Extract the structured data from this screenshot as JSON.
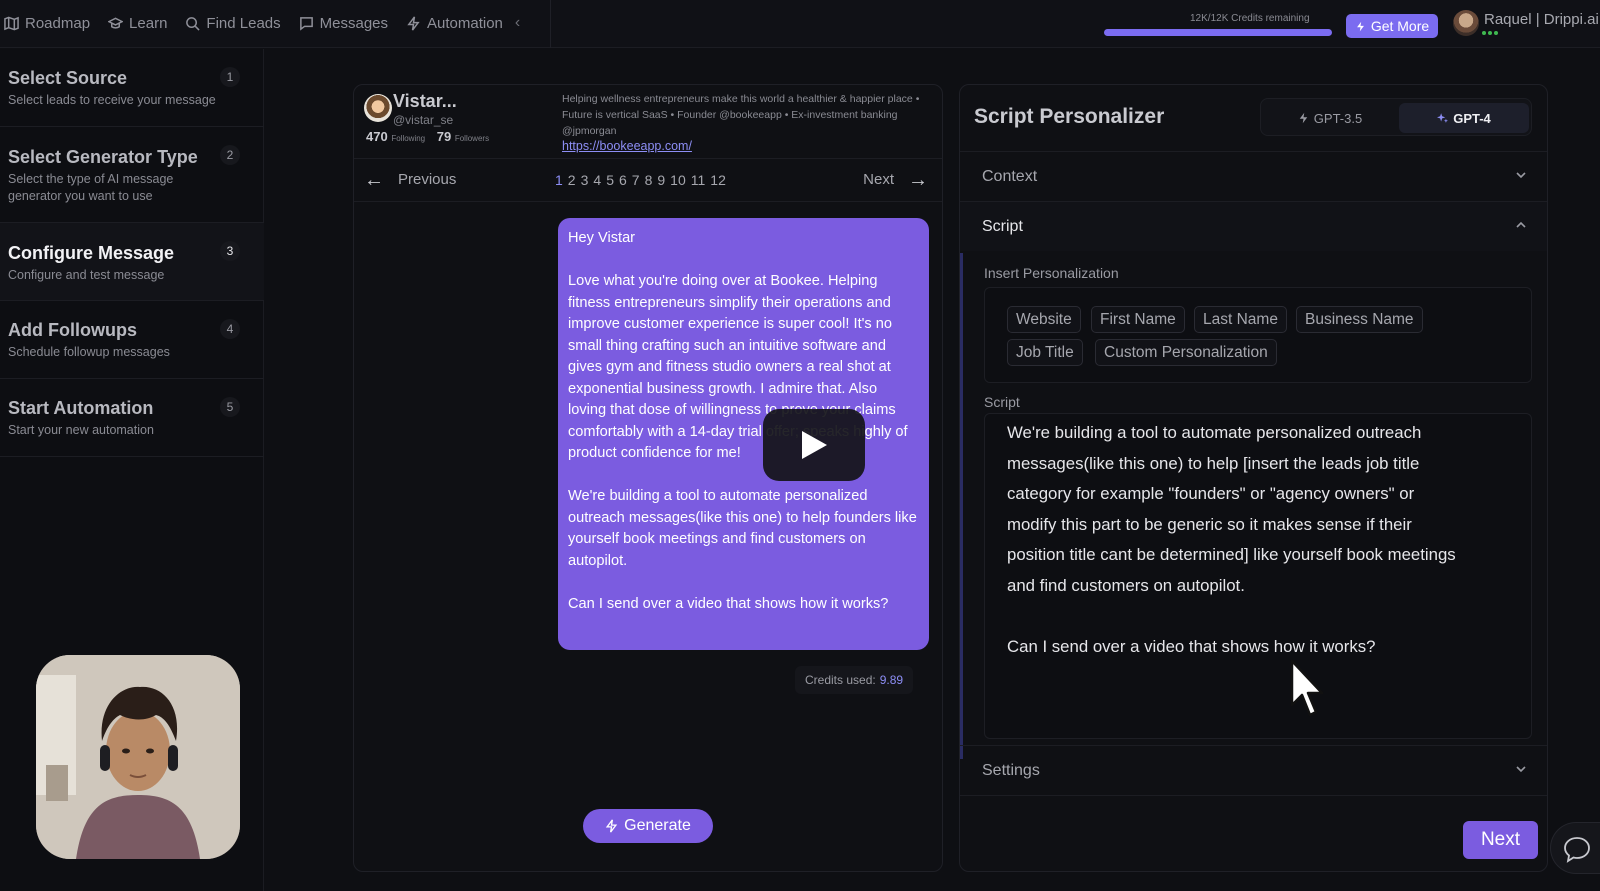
{
  "nav": {
    "items": [
      {
        "label": "Roadmap",
        "icon": "map-icon"
      },
      {
        "label": "Learn",
        "icon": "graduation-cap-icon"
      },
      {
        "label": "Find Leads",
        "icon": "search-icon"
      },
      {
        "label": "Messages",
        "icon": "message-icon"
      },
      {
        "label": "Automation",
        "icon": "lightning-icon"
      }
    ],
    "collapse_glyph": "‹"
  },
  "credits": {
    "text": "12K/12K Credits remaining",
    "fraction": 1.0,
    "get_more_label": "Get More"
  },
  "user": {
    "name": "Raquel | Drippi.ai"
  },
  "steps": [
    {
      "num": "1",
      "title": "Select Source",
      "desc": "Select leads to receive your message"
    },
    {
      "num": "2",
      "title": "Select Generator Type",
      "desc": "Select the type of AI message generator you want to use"
    },
    {
      "num": "3",
      "title": "Configure Message",
      "desc": "Configure and test message"
    },
    {
      "num": "4",
      "title": "Add Followups",
      "desc": "Schedule followup messages"
    },
    {
      "num": "5",
      "title": "Start Automation",
      "desc": "Start your new automation"
    }
  ],
  "profile": {
    "name": "Vistar...",
    "handle": "@vistar_se",
    "following": "470",
    "following_label": "Following",
    "followers": "79",
    "followers_label": "Followers",
    "bio": "Helping wellness entrepreneurs make this world a healthier & happier place • Future is vertical SaaS • Founder @bookeeapp • Ex-investment banking @jpmorgan",
    "link": "https://bookeeapp.com/"
  },
  "pager": {
    "prev_label": "Previous",
    "next_label": "Next",
    "pages": [
      "1",
      "2",
      "3",
      "4",
      "5",
      "6",
      "7",
      "8",
      "9",
      "10",
      "11",
      "12"
    ],
    "current": "1"
  },
  "message": {
    "greeting": "Hey Vistar",
    "p1": "Love what you're doing over at Bookee. Helping fitness entrepreneurs simplify their operations and improve customer experience is super cool! It's no small thing crafting such an intuitive software and gives gym and fitness studio owners a real shot at exponential business growth. I admire that. Also loving that dose of willingness to prove your claims comfortably with a 14-day trial offer; speaks highly of product confidence for me!",
    "p2": "We're building a tool to automate personalized outreach messages(like this one) to help founders like yourself book meetings and find customers on autopilot.",
    "p3": "Can I send over a video that shows how it works?"
  },
  "credits_used": {
    "label": "Credits used:",
    "value": "9.89"
  },
  "generate_label": "Generate",
  "personalizer": {
    "title": "Script Personalizer",
    "models": [
      "GPT-3.5",
      "GPT-4"
    ],
    "selected_model": "GPT-4",
    "sections": {
      "context": "Context",
      "script": "Script",
      "settings": "Settings"
    },
    "insert_label": "Insert Personalization",
    "chips": [
      "Website",
      "First Name",
      "Last Name",
      "Business Name",
      "Job Title",
      "Custom Personalization"
    ],
    "script_label": "Script",
    "script_text": "We're building a tool to automate personalized outreach\nmessages(like this one) to help [insert the leads job title\ncategory for example \"founders\" or \"agency owners\" or\nmodify this part to be generic so it makes sense if their\nposition title cant be determined] like yourself book meetings\nand find customers on autopilot.\n\nCan I send over a video that shows how it works?",
    "next_label": "Next"
  },
  "colors": {
    "accent": "#7b5ce0",
    "link": "#8d8ef5",
    "background": "#0e0f13"
  }
}
